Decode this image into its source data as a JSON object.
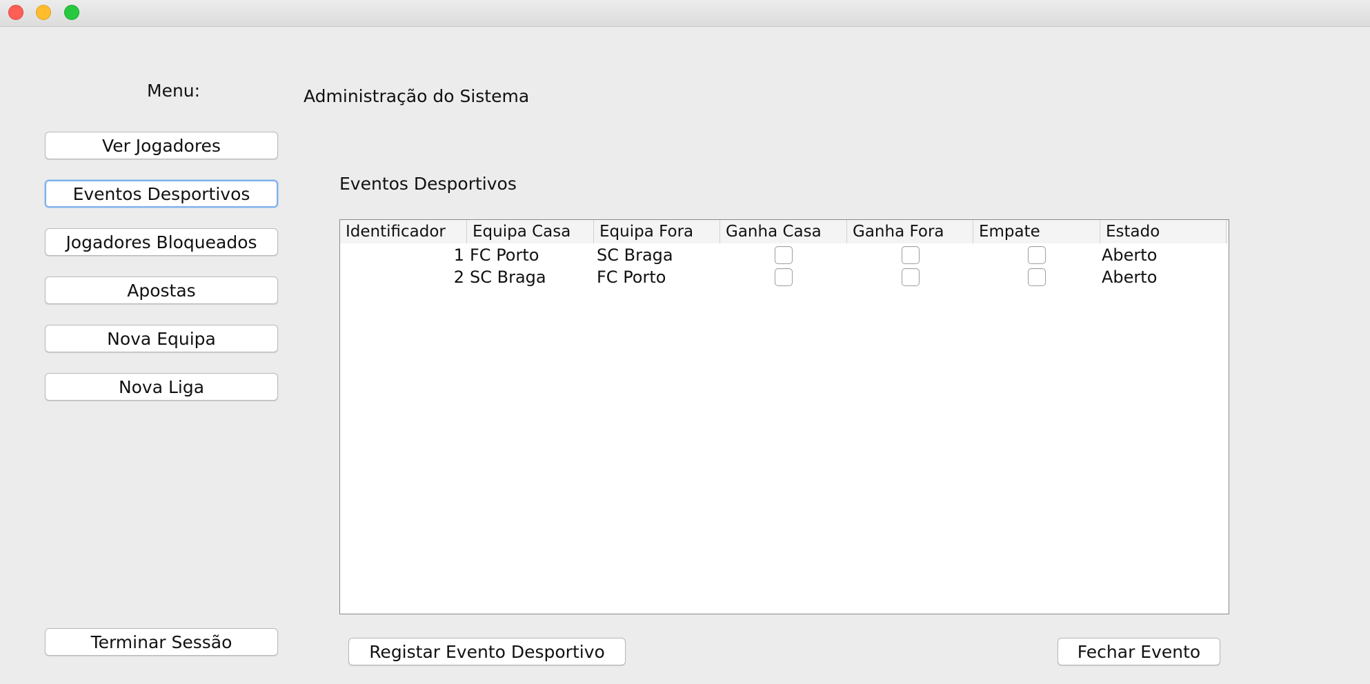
{
  "window": {
    "title": ""
  },
  "menu": {
    "heading": "Menu:",
    "items": [
      {
        "label": "Ver Jogadores",
        "focused": false
      },
      {
        "label": "Eventos Desportivos",
        "focused": true
      },
      {
        "label": "Jogadores Bloqueados",
        "focused": false
      },
      {
        "label": "Apostas",
        "focused": false
      },
      {
        "label": "Nova Equipa",
        "focused": false
      },
      {
        "label": "Nova Liga",
        "focused": false
      }
    ],
    "logout_label": "Terminar Sessão"
  },
  "header": {
    "title": "Administração do Sistema"
  },
  "section": {
    "title": "Eventos Desportivos"
  },
  "table": {
    "columns": [
      "Identificador",
      "Equipa Casa",
      "Equipa Fora",
      "Ganha Casa",
      "Ganha Fora",
      "Empate",
      "Estado"
    ],
    "rows": [
      {
        "id": "1",
        "home": "FC Porto",
        "away": "SC Braga",
        "win_home": false,
        "win_away": false,
        "draw": false,
        "status": "Aberto"
      },
      {
        "id": "2",
        "home": "SC Braga",
        "away": "FC Porto",
        "win_home": false,
        "win_away": false,
        "draw": false,
        "status": "Aberto"
      }
    ]
  },
  "actions": {
    "register_label": "Registar Evento Desportivo",
    "close_label": "Fechar Evento"
  },
  "colors": {
    "focus_ring": "#7fb0ea",
    "window_bg": "#ececec"
  }
}
